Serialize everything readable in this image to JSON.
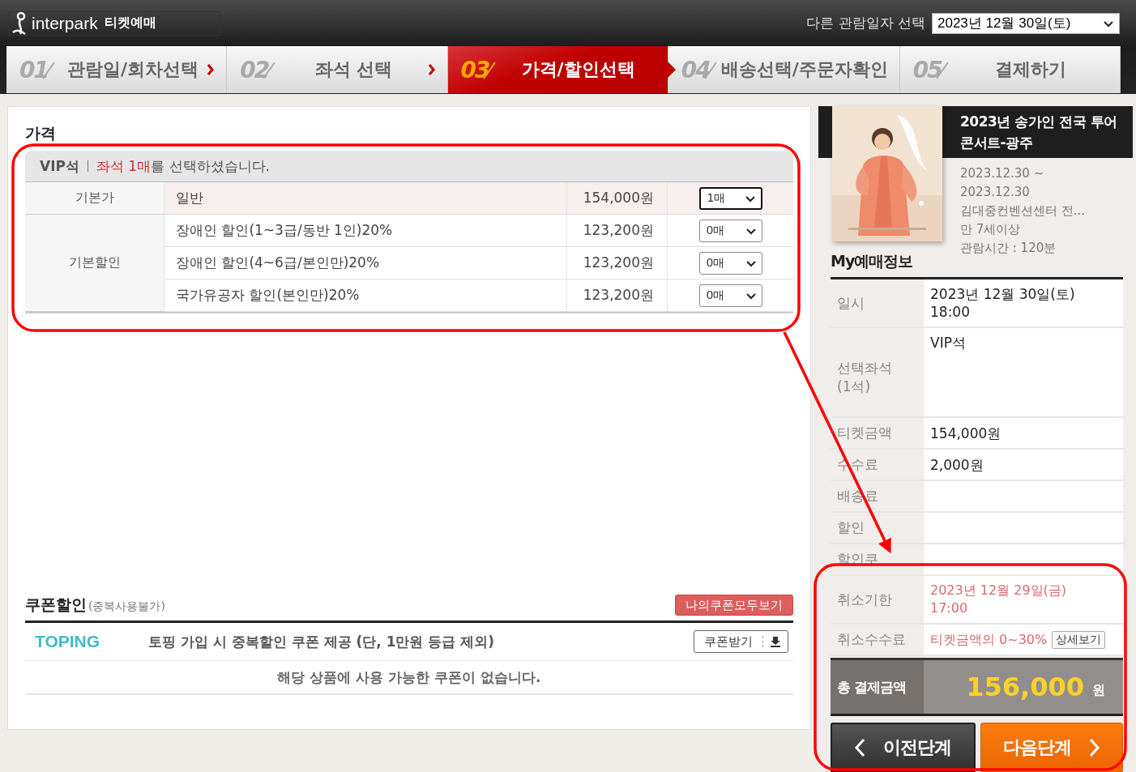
{
  "header": {
    "logo": "interpark",
    "logo_sub": "티켓예매",
    "date_label": "다른 관람일자 선택",
    "date_value": "2023년 12월 30일(토)"
  },
  "steps": [
    {
      "number": "01",
      "label": "관람일/회차선택",
      "selected": false
    },
    {
      "number": "02",
      "label": "좌석 선택",
      "selected": false
    },
    {
      "number": "03",
      "label": "가격/할인선택",
      "selected": true
    },
    {
      "number": "04",
      "label": "배송선택/주문자확인",
      "selected": false
    },
    {
      "number": "05",
      "label": "결제하기",
      "selected": false
    }
  ],
  "price": {
    "title": "가격",
    "grade": "VIP석",
    "message": "**좌석 1매**를 선택하셨습니다.",
    "groups": [
      {
        "category": "기본가",
        "options": [
          {
            "name": "일반",
            "price": "154,000원",
            "quantity": "1매",
            "selected": true
          }
        ]
      },
      {
        "category": "기본할인",
        "options": [
          {
            "name": "장애인 할인(1~3급/동반 1인)20%",
            "price": "123,200원",
            "quantity": "0매",
            "selected": false
          },
          {
            "name": "장애인 할인(4~6급/본인만)20%",
            "price": "123,200원",
            "quantity": "0매",
            "selected": false
          },
          {
            "name": "국가유공자 할인(본인만)20%",
            "price": "123,200원",
            "quantity": "0매",
            "selected": false
          }
        ]
      }
    ]
  },
  "coupon": {
    "title": "쿠폰할인",
    "note": "(중복사용불가)",
    "view_all": "나의쿠폰모두보기",
    "promo": {
      "brand": "TOPING",
      "text": "토핑 가입 시 중복할인 쿠폰 제공 (단, 1만원 등급 제외)",
      "button": "쿠폰받기"
    },
    "empty_message": "해당 상품에 사용 가능한 쿠폰이 없습니다."
  },
  "show": {
    "title": "2023년 송가인 전국 투어 콘서트-광주",
    "info": [
      "2023.12.30 ~",
      "2023.12.30",
      "김대중컨벤션센터 전...",
      "만 7세이상",
      "관람시간 : 120분"
    ]
  },
  "booking": {
    "title": "My예매정보",
    "rows": [
      {
        "label": "일시",
        "value": "2023년 12월 30일(토)\n18:00",
        "kind": "plain"
      },
      {
        "label": "선택좌석\n(1석)",
        "value": "VIP석",
        "kind": "tall"
      },
      {
        "label": "티켓금액",
        "value": "154,000원",
        "kind": "plain"
      },
      {
        "label": "수수료",
        "value": "2,000원",
        "kind": "plain"
      },
      {
        "label": "배송료",
        "kind": "plain"
      },
      {
        "label": "할인",
        "kind": "plain"
      },
      {
        "label": "할인쿠",
        "kind": "plain"
      },
      {
        "label": "취소기한",
        "value": "2023년 12월 29일(금)\n17:00",
        "kind": "alert"
      },
      {
        "label": "취소수수료",
        "value": "티켓금액의 0~30%",
        "kind": "alert",
        "button": "상세보기"
      }
    ],
    "total_label": "총 결제금액",
    "total": "156,000",
    "total_unit": "원",
    "prev": "이전단계",
    "next": "다음단계"
  },
  "annotations": [
    {
      "kind": "outline"
    },
    {
      "kind": "arrow"
    },
    {
      "kind": "outline"
    }
  ]
}
